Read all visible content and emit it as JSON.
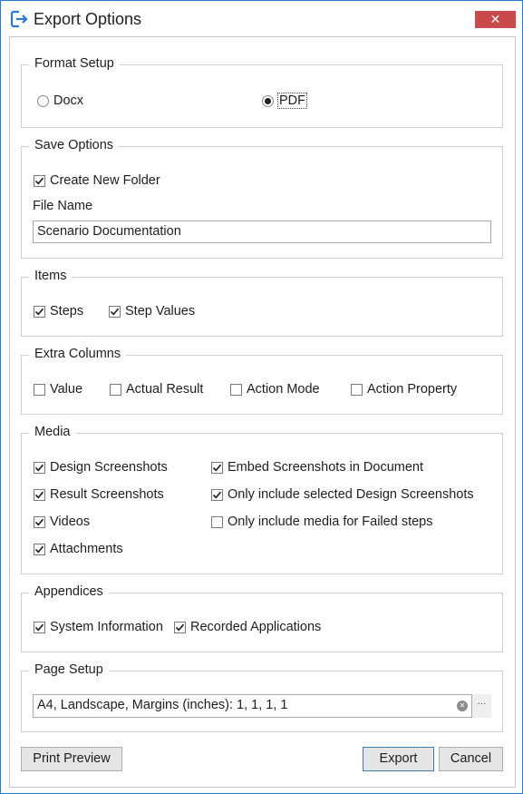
{
  "window": {
    "title": "Export Options",
    "close_glyph": "✕",
    "app_icon": "export-icon"
  },
  "format_setup": {
    "title": "Format Setup",
    "options": [
      {
        "label": "Docx",
        "selected": false
      },
      {
        "label": "PDF",
        "selected": true
      }
    ]
  },
  "save_options": {
    "title": "Save Options",
    "create_new_folder": {
      "label": "Create New Folder",
      "checked": true
    },
    "file_name_label": "File Name",
    "file_name_value": "Scenario Documentation"
  },
  "items": {
    "title": "Items",
    "options": [
      {
        "label": "Steps",
        "checked": true
      },
      {
        "label": "Step Values",
        "checked": true
      }
    ]
  },
  "extra_columns": {
    "title": "Extra Columns",
    "options": [
      {
        "label": "Value",
        "checked": false
      },
      {
        "label": "Actual Result",
        "checked": false
      },
      {
        "label": "Action Mode",
        "checked": false
      },
      {
        "label": "Action Property",
        "checked": false
      }
    ]
  },
  "media": {
    "title": "Media",
    "options": [
      {
        "label": "Design Screenshots",
        "checked": true
      },
      {
        "label": "Result Screenshots",
        "checked": true
      },
      {
        "label": "Videos",
        "checked": true
      },
      {
        "label": "Attachments",
        "checked": true
      },
      {
        "label": "Embed Screenshots in Document",
        "checked": true
      },
      {
        "label": "Only include selected Design Screenshots",
        "checked": true
      },
      {
        "label": "Only include media for Failed steps",
        "checked": false
      }
    ]
  },
  "appendices": {
    "title": "Appendices",
    "options": [
      {
        "label": "System Information",
        "checked": true
      },
      {
        "label": "Recorded Applications",
        "checked": true
      }
    ]
  },
  "page_setup": {
    "title": "Page Setup",
    "value": "A4, Landscape, Margins (inches): 1, 1, 1, 1",
    "clear_glyph": "✕",
    "browse_glyph": "···"
  },
  "buttons": {
    "print_preview": "Print Preview",
    "export": "Export",
    "cancel": "Cancel"
  },
  "colors": {
    "accent": "#2b79d6",
    "close": "#c94a4a",
    "check": "#1e1e1e"
  }
}
